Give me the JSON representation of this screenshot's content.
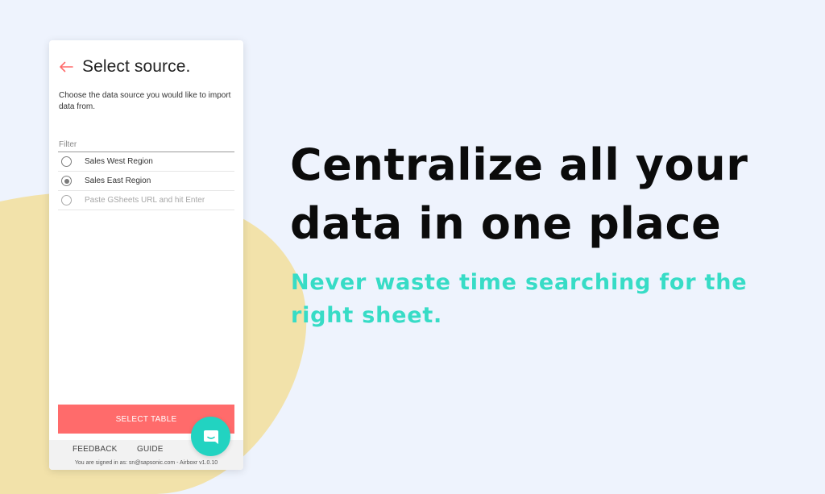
{
  "colors": {
    "background": "#eef3fd",
    "blob": "#f2e2aa",
    "accent_red": "#ff6b6b",
    "teal": "#37dcc6",
    "chat_button": "#22d3c1"
  },
  "panel": {
    "back_icon": "arrow-left-icon",
    "title": "Select source.",
    "description": "Choose the data source you would like to import data from.",
    "filter_placeholder": "Filter",
    "filter_value": "",
    "options": [
      {
        "label": "Sales West Region",
        "selected": false,
        "faded": false
      },
      {
        "label": "Sales East Region",
        "selected": true,
        "faded": false
      },
      {
        "label": "Paste GSheets URL and hit Enter",
        "selected": false,
        "faded": true
      }
    ],
    "select_button_label": "SELECT TABLE",
    "footer": {
      "feedback_label": "FEEDBACK",
      "guide_label": "GUIDE",
      "signed_in_text": "You are signed in as: sn@sapsonic.com - Airboxr v1.0.10"
    },
    "chat_icon": "chat-bubble-icon"
  },
  "hero": {
    "headline": "Centralize all your data in one place",
    "subline": "Never waste time searching for the right sheet."
  }
}
